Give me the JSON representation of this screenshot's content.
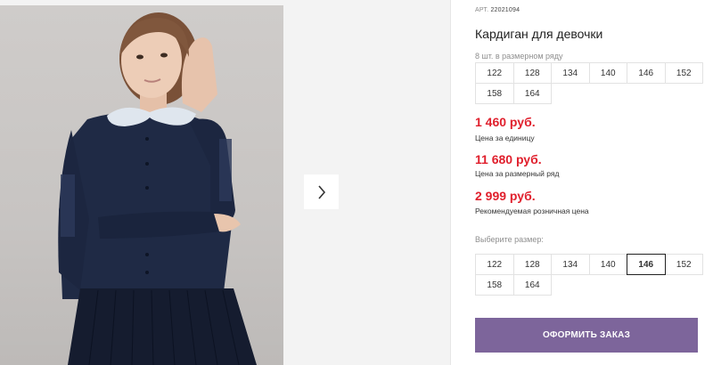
{
  "product": {
    "article_label": "АРТ.",
    "article_value": "22021094",
    "title": "Кардиган для девочки"
  },
  "size_row": {
    "label": "8 шт. в размерном ряду",
    "sizes": [
      "122",
      "128",
      "134",
      "140",
      "146",
      "152",
      "158",
      "164"
    ]
  },
  "prices": {
    "unit_price": "1 460 руб.",
    "unit_label": "Цена за единицу",
    "row_price": "11 680 руб.",
    "row_label": "Цена за размерный ряд",
    "retail_price": "2 999 руб.",
    "retail_label": "Рекомендуемая розничная цена"
  },
  "size_select": {
    "label": "Выберите размер:",
    "sizes": [
      "122",
      "128",
      "134",
      "140",
      "146",
      "152",
      "158",
      "164"
    ],
    "selected": "146"
  },
  "order_button": "ОФОРМИТЬ ЗАКАЗ",
  "gallery": {
    "next_icon": "chevron-right-icon"
  },
  "colors": {
    "price": "#e0202d",
    "button": "#7d659b",
    "photo_bg": "#cfccca",
    "cardigan": "#1f2a45"
  }
}
